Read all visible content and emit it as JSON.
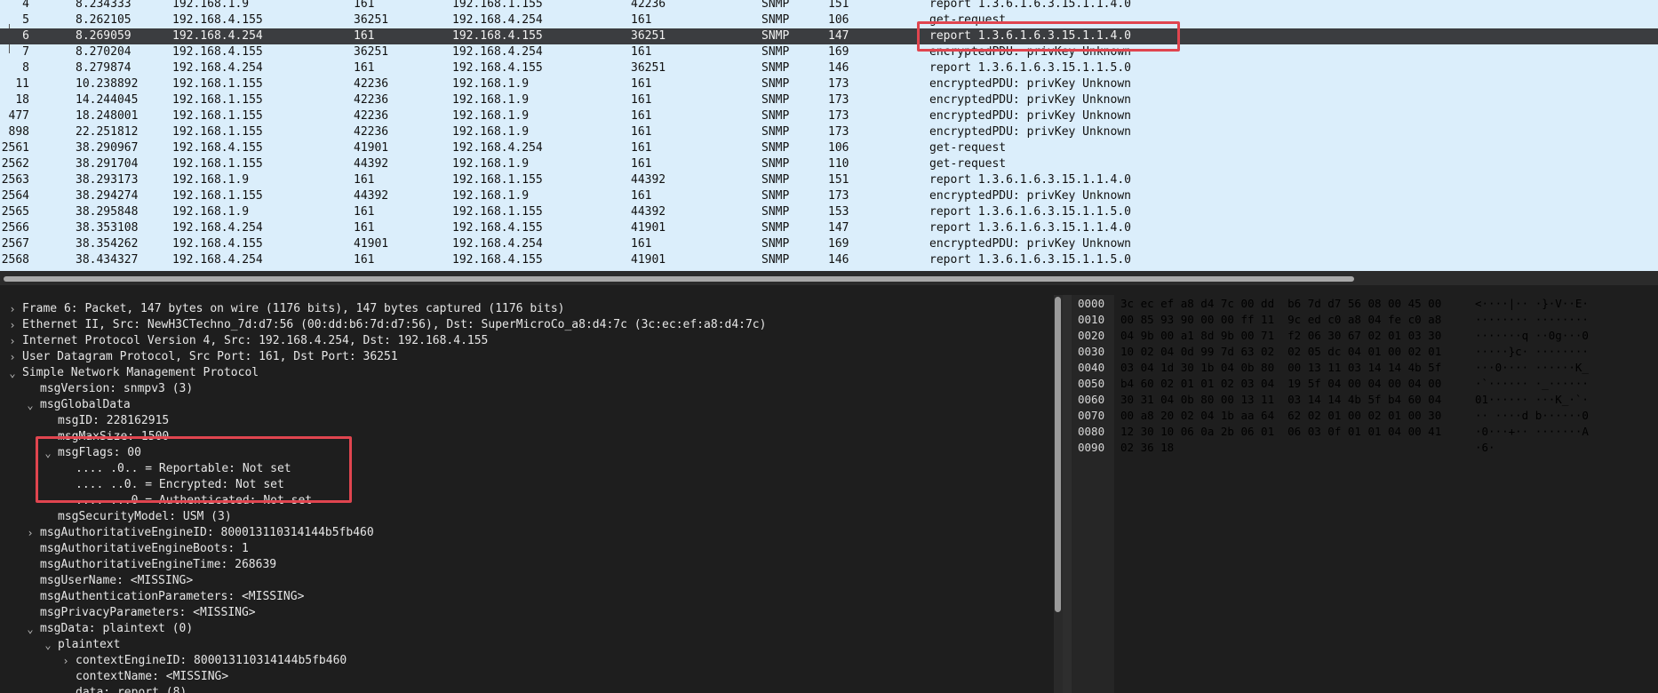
{
  "packet_list": {
    "selected_index": 2,
    "rows": [
      {
        "no": "4",
        "time": "8.234333",
        "src": "192.168.1.9",
        "sport": "161",
        "dst": "192.168.1.155",
        "dport": "42236",
        "proto": "SNMP",
        "len": "151",
        "info": "report 1.3.6.1.6.3.15.1.1.4.0"
      },
      {
        "no": "5",
        "time": "8.262105",
        "src": "192.168.4.155",
        "sport": "36251",
        "dst": "192.168.4.254",
        "dport": "161",
        "proto": "SNMP",
        "len": "106",
        "info": "get-request"
      },
      {
        "no": "6",
        "time": "8.269059",
        "src": "192.168.4.254",
        "sport": "161",
        "dst": "192.168.4.155",
        "dport": "36251",
        "proto": "SNMP",
        "len": "147",
        "info": "report 1.3.6.1.6.3.15.1.1.4.0"
      },
      {
        "no": "7",
        "time": "8.270204",
        "src": "192.168.4.155",
        "sport": "36251",
        "dst": "192.168.4.254",
        "dport": "161",
        "proto": "SNMP",
        "len": "169",
        "info": "encryptedPDU: privKey Unknown"
      },
      {
        "no": "8",
        "time": "8.279874",
        "src": "192.168.4.254",
        "sport": "161",
        "dst": "192.168.4.155",
        "dport": "36251",
        "proto": "SNMP",
        "len": "146",
        "info": "report 1.3.6.1.6.3.15.1.1.5.0"
      },
      {
        "no": "11",
        "time": "10.238892",
        "src": "192.168.1.155",
        "sport": "42236",
        "dst": "192.168.1.9",
        "dport": "161",
        "proto": "SNMP",
        "len": "173",
        "info": "encryptedPDU: privKey Unknown"
      },
      {
        "no": "18",
        "time": "14.244045",
        "src": "192.168.1.155",
        "sport": "42236",
        "dst": "192.168.1.9",
        "dport": "161",
        "proto": "SNMP",
        "len": "173",
        "info": "encryptedPDU: privKey Unknown"
      },
      {
        "no": "477",
        "time": "18.248001",
        "src": "192.168.1.155",
        "sport": "42236",
        "dst": "192.168.1.9",
        "dport": "161",
        "proto": "SNMP",
        "len": "173",
        "info": "encryptedPDU: privKey Unknown"
      },
      {
        "no": "898",
        "time": "22.251812",
        "src": "192.168.1.155",
        "sport": "42236",
        "dst": "192.168.1.9",
        "dport": "161",
        "proto": "SNMP",
        "len": "173",
        "info": "encryptedPDU: privKey Unknown"
      },
      {
        "no": "2561",
        "time": "38.290967",
        "src": "192.168.4.155",
        "sport": "41901",
        "dst": "192.168.4.254",
        "dport": "161",
        "proto": "SNMP",
        "len": "106",
        "info": "get-request"
      },
      {
        "no": "2562",
        "time": "38.291704",
        "src": "192.168.1.155",
        "sport": "44392",
        "dst": "192.168.1.9",
        "dport": "161",
        "proto": "SNMP",
        "len": "110",
        "info": "get-request"
      },
      {
        "no": "2563",
        "time": "38.293173",
        "src": "192.168.1.9",
        "sport": "161",
        "dst": "192.168.1.155",
        "dport": "44392",
        "proto": "SNMP",
        "len": "151",
        "info": "report 1.3.6.1.6.3.15.1.1.4.0"
      },
      {
        "no": "2564",
        "time": "38.294274",
        "src": "192.168.1.155",
        "sport": "44392",
        "dst": "192.168.1.9",
        "dport": "161",
        "proto": "SNMP",
        "len": "173",
        "info": "encryptedPDU: privKey Unknown"
      },
      {
        "no": "2565",
        "time": "38.295848",
        "src": "192.168.1.9",
        "sport": "161",
        "dst": "192.168.1.155",
        "dport": "44392",
        "proto": "SNMP",
        "len": "153",
        "info": "report 1.3.6.1.6.3.15.1.1.5.0"
      },
      {
        "no": "2566",
        "time": "38.353108",
        "src": "192.168.4.254",
        "sport": "161",
        "dst": "192.168.4.155",
        "dport": "41901",
        "proto": "SNMP",
        "len": "147",
        "info": "report 1.3.6.1.6.3.15.1.1.4.0"
      },
      {
        "no": "2567",
        "time": "38.354262",
        "src": "192.168.4.155",
        "sport": "41901",
        "dst": "192.168.4.254",
        "dport": "161",
        "proto": "SNMP",
        "len": "169",
        "info": "encryptedPDU: privKey Unknown"
      },
      {
        "no": "2568",
        "time": "38.434327",
        "src": "192.168.4.254",
        "sport": "161",
        "dst": "192.168.4.155",
        "dport": "41901",
        "proto": "SNMP",
        "len": "146",
        "info": "report 1.3.6.1.6.3.15.1.1.5.0"
      }
    ]
  },
  "details": [
    {
      "level": 0,
      "caret": "right",
      "text": "Frame 6: Packet, 147 bytes on wire (1176 bits), 147 bytes captured (1176 bits)"
    },
    {
      "level": 0,
      "caret": "right",
      "text": "Ethernet II, Src: NewH3CTechno_7d:d7:56 (00:dd:b6:7d:d7:56), Dst: SuperMicroCo_a8:d4:7c (3c:ec:ef:a8:d4:7c)"
    },
    {
      "level": 0,
      "caret": "right",
      "text": "Internet Protocol Version 4, Src: 192.168.4.254, Dst: 192.168.4.155"
    },
    {
      "level": 0,
      "caret": "right",
      "text": "User Datagram Protocol, Src Port: 161, Dst Port: 36251"
    },
    {
      "level": 0,
      "caret": "down",
      "text": "Simple Network Management Protocol"
    },
    {
      "level": 1,
      "caret": "none",
      "text": "msgVersion: snmpv3 (3)"
    },
    {
      "level": 1,
      "caret": "down",
      "text": "msgGlobalData"
    },
    {
      "level": 2,
      "caret": "none",
      "text": "msgID: 228162915"
    },
    {
      "level": 2,
      "caret": "none",
      "text": "msgMaxSize: 1500"
    },
    {
      "level": 2,
      "caret": "down",
      "text": "msgFlags: 00"
    },
    {
      "level": 3,
      "caret": "none",
      "text": ".... .0.. = Reportable: Not set"
    },
    {
      "level": 3,
      "caret": "none",
      "text": ".... ..0. = Encrypted: Not set"
    },
    {
      "level": 3,
      "caret": "none",
      "text": ".... ...0 = Authenticated: Not set"
    },
    {
      "level": 2,
      "caret": "none",
      "text": "msgSecurityModel: USM (3)"
    },
    {
      "level": 1,
      "caret": "right",
      "text": "msgAuthoritativeEngineID: 800013110314144b5fb460"
    },
    {
      "level": 1,
      "caret": "none",
      "text": "msgAuthoritativeEngineBoots: 1"
    },
    {
      "level": 1,
      "caret": "none",
      "text": "msgAuthoritativeEngineTime: 268639"
    },
    {
      "level": 1,
      "caret": "none",
      "text": "msgUserName: <MISSING>"
    },
    {
      "level": 1,
      "caret": "none",
      "text": "msgAuthenticationParameters: <MISSING>"
    },
    {
      "level": 1,
      "caret": "none",
      "text": "msgPrivacyParameters: <MISSING>"
    },
    {
      "level": 1,
      "caret": "down",
      "text": "msgData: plaintext (0)"
    },
    {
      "level": 2,
      "caret": "down",
      "text": "plaintext"
    },
    {
      "level": 3,
      "caret": "right",
      "text": "contextEngineID: 800013110314144b5fb460"
    },
    {
      "level": 3,
      "caret": "none",
      "text": "contextName: <MISSING>"
    },
    {
      "level": 3,
      "caret": "down",
      "text": "data: report (8)"
    }
  ],
  "bytes": [
    {
      "offset": "0000",
      "hex": "3c ec ef a8 d4 7c 00 dd  b6 7d d7 56 08 00 45 00",
      "ascii": "<····|·· ·}·V··E·"
    },
    {
      "offset": "0010",
      "hex": "00 85 93 90 00 00 ff 11  9c ed c0 a8 04 fe c0 a8",
      "ascii": "········ ········"
    },
    {
      "offset": "0020",
      "hex": "04 9b 00 a1 8d 9b 00 71  f2 06 30 67 02 01 03 30",
      "ascii": "·······q ··0g···0"
    },
    {
      "offset": "0030",
      "hex": "10 02 04 0d 99 7d 63 02  02 05 dc 04 01 00 02 01",
      "ascii": "·····}c· ········"
    },
    {
      "offset": "0040",
      "hex": "03 04 1d 30 1b 04 0b 80  00 13 11 03 14 14 4b 5f",
      "ascii": "···0···· ······K_"
    },
    {
      "offset": "0050",
      "hex": "b4 60 02 01 01 02 03 04  19 5f 04 00 04 00 04 00",
      "ascii": "·`······ ·_······"
    },
    {
      "offset": "0060",
      "hex": "30 31 04 0b 80 00 13 11  03 14 14 4b 5f b4 60 04",
      "ascii": "01······ ···K_·`·"
    },
    {
      "offset": "0070",
      "hex": "00 a8 20 02 04 1b aa 64  62 02 01 00 02 01 00 30",
      "ascii": "·· ····d b······0"
    },
    {
      "offset": "0080",
      "hex": "12 30 10 06 0a 2b 06 01  06 03 0f 01 01 04 00 41",
      "ascii": "·0···+·· ·······A"
    },
    {
      "offset": "0090",
      "hex": "02 36 18",
      "ascii": "·6·"
    }
  ],
  "colors": {
    "list_bg": "#dbeefb",
    "selected_row_bg": "#3b3d40",
    "pane_bg": "#1e1e1e",
    "highlight_red": "#e0454f"
  },
  "icons": {
    "collapsed": "chevron-right-icon",
    "expanded": "chevron-down-icon"
  }
}
